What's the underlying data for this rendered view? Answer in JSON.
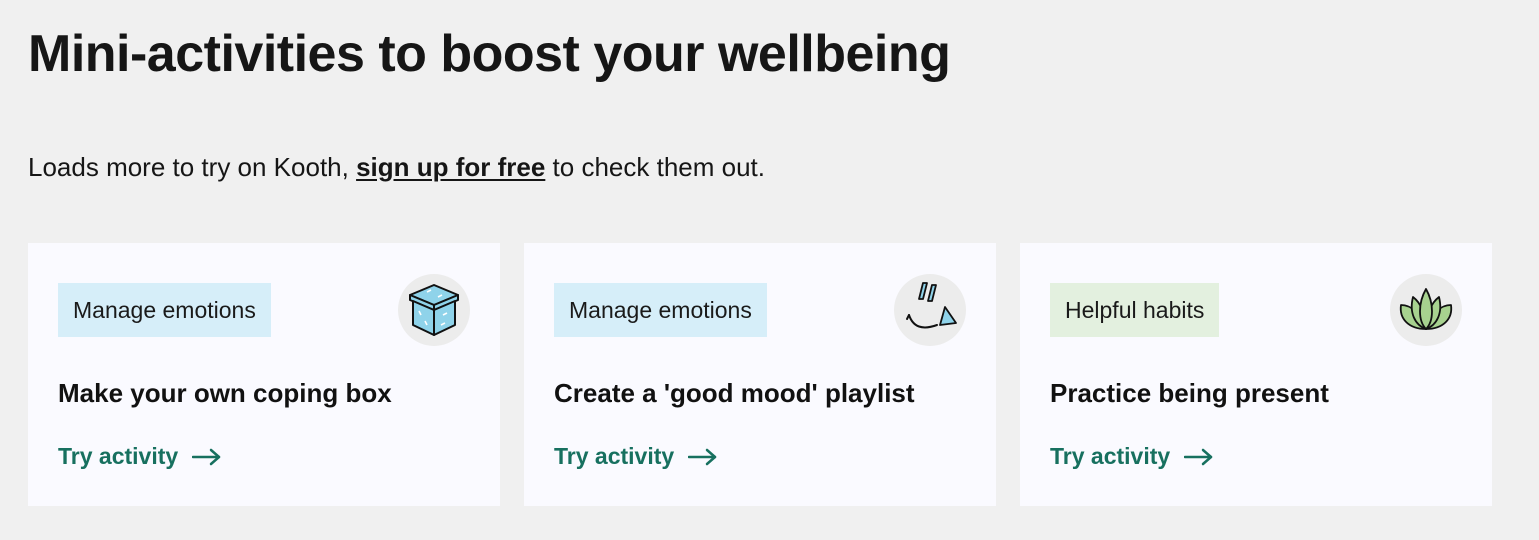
{
  "page": {
    "title": "Mini-activities to boost your wellbeing",
    "intro_before": "Loads more to try on Kooth, ",
    "intro_link": "sign up for free",
    "intro_after": " to check them out."
  },
  "colors": {
    "background": "#f0f0f0",
    "card": "#fafaff",
    "cta": "#17705f",
    "tag_emotions": "#d6eef9",
    "tag_habits": "#e3f0df",
    "icon_blue": "#8fd3ea",
    "icon_green": "#a7d28f"
  },
  "cards": [
    {
      "tag": "Manage emotions",
      "tag_color": "#d6eef9",
      "icon": "coping-box-icon",
      "title": "Make your own coping box",
      "cta": "Try activity"
    },
    {
      "tag": "Manage emotions",
      "tag_color": "#d6eef9",
      "icon": "music-smile-icon",
      "title": "Create a 'good mood' playlist",
      "cta": "Try activity"
    },
    {
      "tag": "Helpful habits",
      "tag_color": "#e3f0df",
      "icon": "lotus-icon",
      "title": "Practice being present",
      "cta": "Try activity"
    }
  ]
}
